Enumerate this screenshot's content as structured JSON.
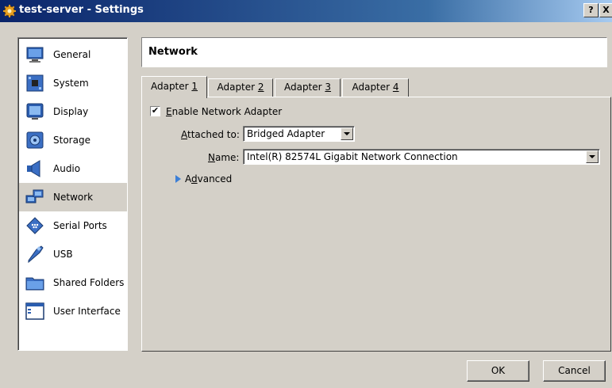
{
  "window": {
    "title": "test-server - Settings",
    "help_label": "?",
    "close_label": "X"
  },
  "sidebar": {
    "items": [
      {
        "label": "General",
        "icon": "monitor-icon"
      },
      {
        "label": "System",
        "icon": "motherboard-icon"
      },
      {
        "label": "Display",
        "icon": "display-icon"
      },
      {
        "label": "Storage",
        "icon": "storage-icon"
      },
      {
        "label": "Audio",
        "icon": "speaker-icon"
      },
      {
        "label": "Network",
        "icon": "network-icon",
        "selected": true
      },
      {
        "label": "Serial Ports",
        "icon": "serial-port-icon"
      },
      {
        "label": "USB",
        "icon": "usb-icon"
      },
      {
        "label": "Shared Folders",
        "icon": "folder-icon"
      },
      {
        "label": "User Interface",
        "icon": "window-icon"
      }
    ]
  },
  "header": {
    "title": "Network"
  },
  "tabs": [
    {
      "label": "Adapter ",
      "mnemonic": "1",
      "active": true
    },
    {
      "label": "Adapter ",
      "mnemonic": "2"
    },
    {
      "label": "Adapter ",
      "mnemonic": "3"
    },
    {
      "label": "Adapter ",
      "mnemonic": "4"
    }
  ],
  "adapter": {
    "enable": {
      "checked": true,
      "mark": "✔",
      "mnemonic": "E",
      "rest": "nable Network Adapter"
    },
    "attached_to": {
      "label_mnemonic": "A",
      "label_rest": "ttached to:",
      "value": "Bridged Adapter"
    },
    "name": {
      "label_mnemonic": "N",
      "label_rest": "ame:",
      "value": "Intel(R) 82574L Gigabit Network Connection"
    },
    "advanced": {
      "prefix": "A",
      "mnemonic": "d",
      "rest": "vanced"
    }
  },
  "buttons": {
    "ok": "OK",
    "cancel": "Cancel"
  },
  "colors": {
    "title_gradient_start": "#0a246a",
    "title_gradient_end": "#a6caf0",
    "face": "#d4d0c8",
    "accent_blue": "#3d7fd6"
  }
}
